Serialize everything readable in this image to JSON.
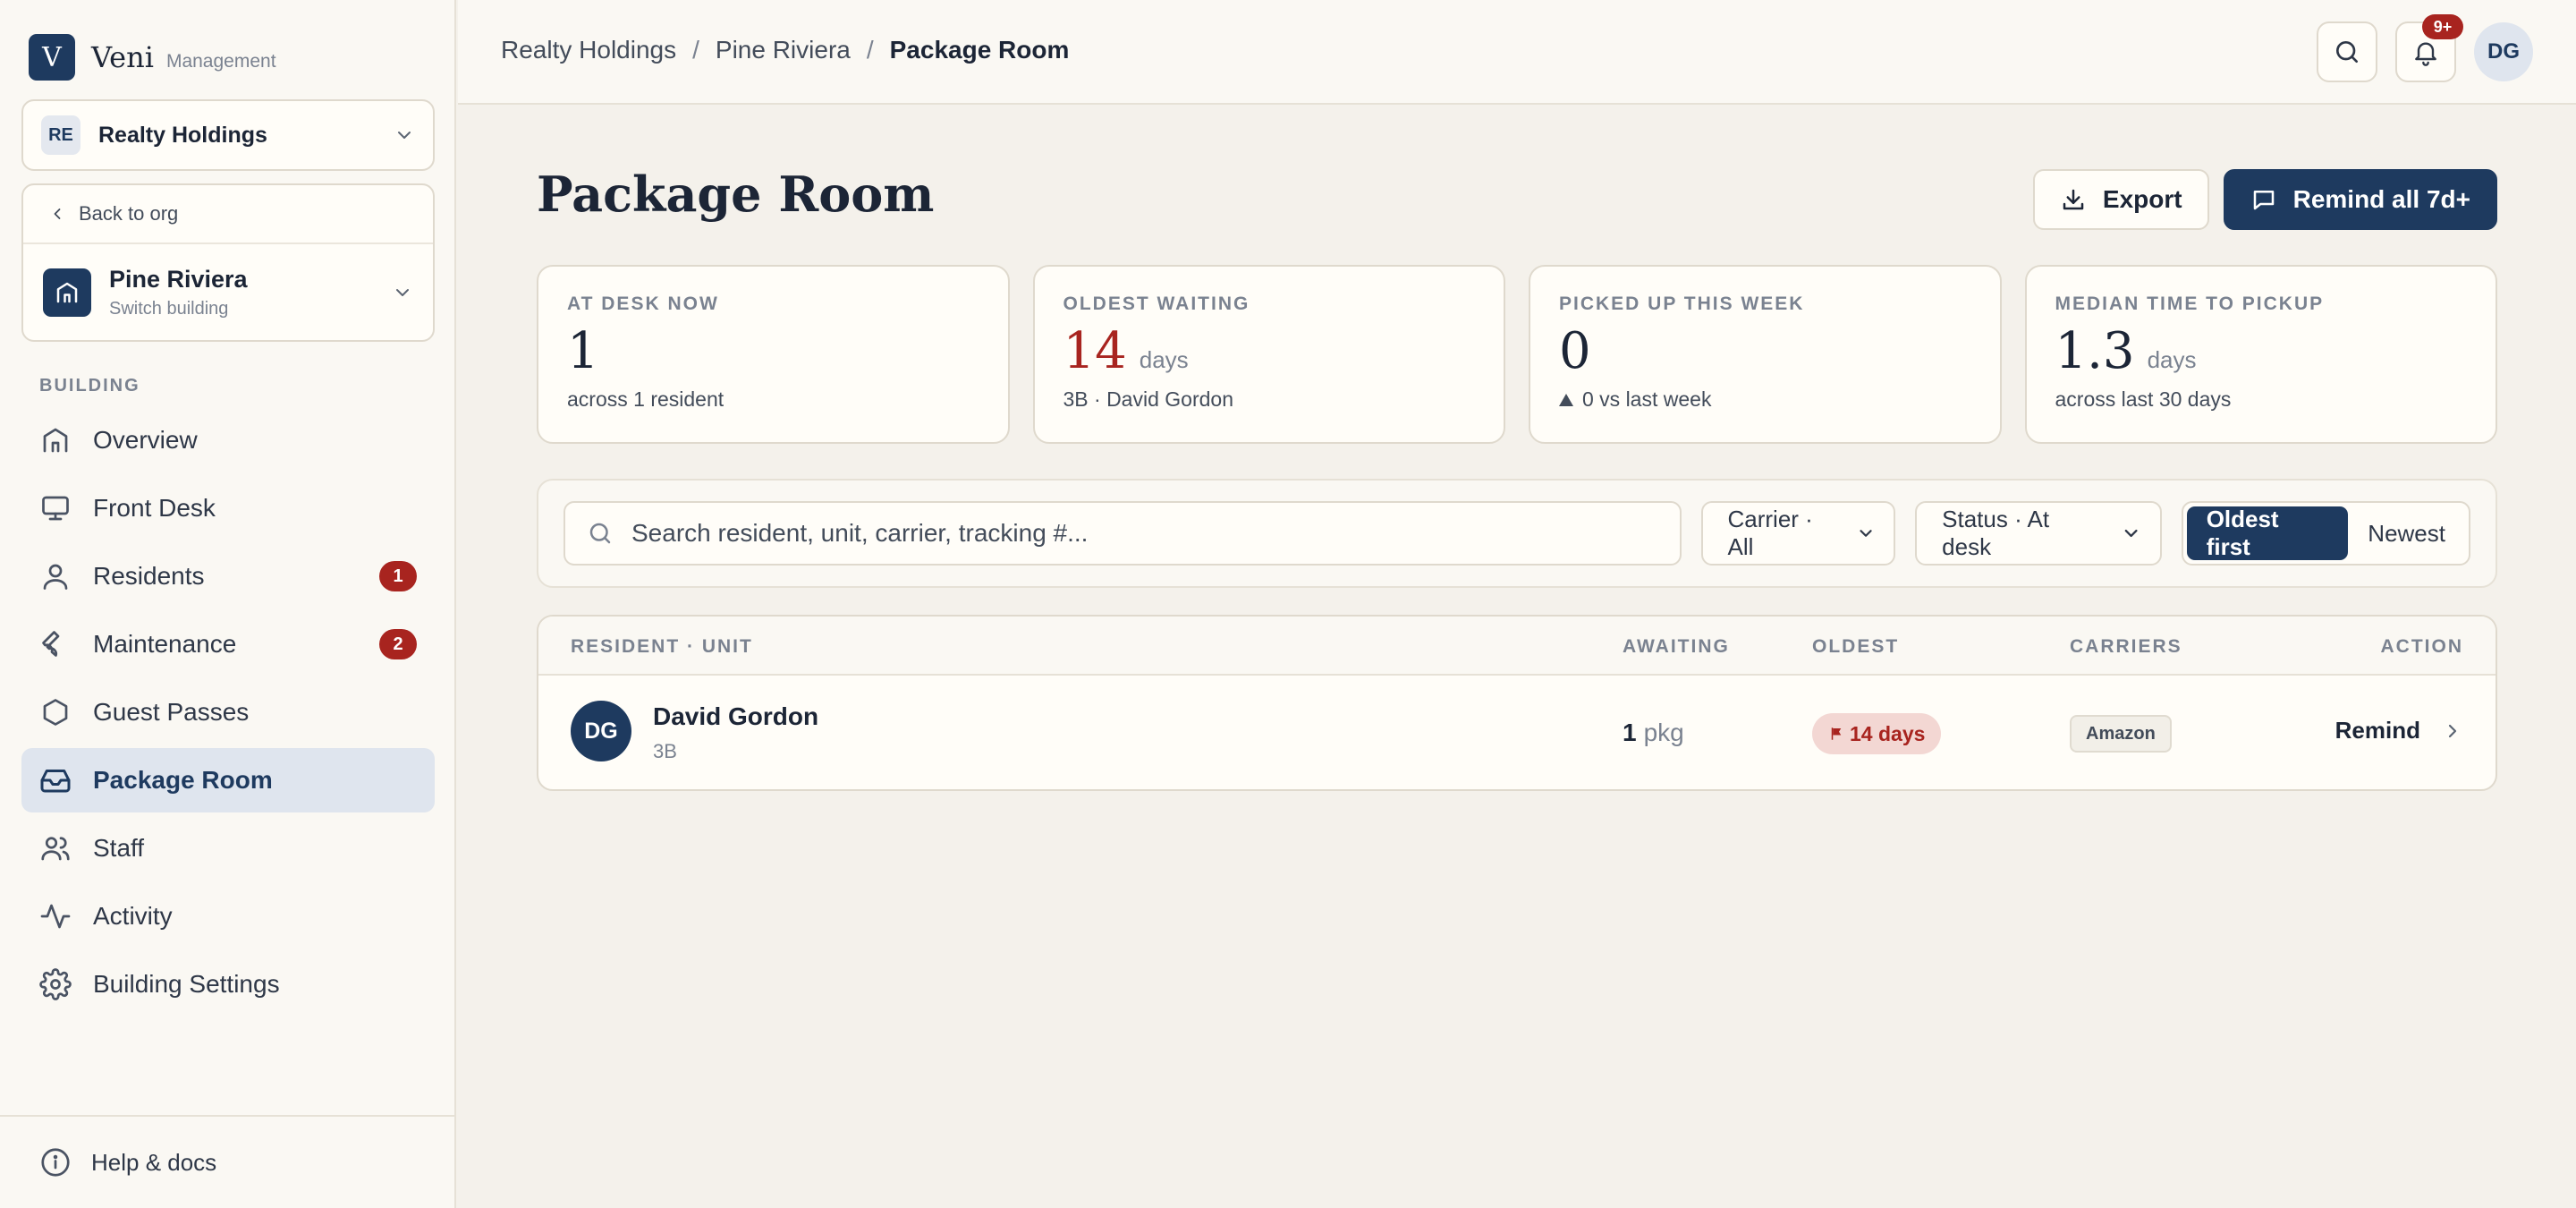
{
  "brand": {
    "logo_letter": "V",
    "name": "Veni",
    "sub": "Management"
  },
  "org": {
    "badge": "RE",
    "name": "Realty Holdings"
  },
  "building": {
    "back_label": "Back to org",
    "name": "Pine Riviera",
    "sub": "Switch building"
  },
  "nav": {
    "section_label": "BUILDING",
    "items": [
      {
        "label": "Overview",
        "icon": "home-icon"
      },
      {
        "label": "Front Desk",
        "icon": "monitor-icon"
      },
      {
        "label": "Residents",
        "icon": "user-icon",
        "badge": "1"
      },
      {
        "label": "Maintenance",
        "icon": "wrench-icon",
        "badge": "2"
      },
      {
        "label": "Guest Passes",
        "icon": "hexagon-icon"
      },
      {
        "label": "Package Room",
        "icon": "inbox-icon",
        "active": true
      },
      {
        "label": "Staff",
        "icon": "users-icon"
      },
      {
        "label": "Activity",
        "icon": "activity-icon"
      },
      {
        "label": "Building Settings",
        "icon": "gear-icon"
      }
    ],
    "footer_label": "Help & docs"
  },
  "topbar": {
    "breadcrumb": [
      "Realty Holdings",
      "Pine Riviera",
      "Package Room"
    ],
    "separator": "/",
    "notif_badge": "9+",
    "user_initials": "DG"
  },
  "page": {
    "title": "Package Room",
    "export_label": "Export",
    "remind_all_label": "Remind all 7d+"
  },
  "stats": [
    {
      "label": "AT DESK NOW",
      "value": "1",
      "unit": "",
      "sub": "across 1 resident"
    },
    {
      "label": "OLDEST WAITING",
      "value": "14",
      "unit": "days",
      "sub": "3B · David Gordon"
    },
    {
      "label": "PICKED UP THIS WEEK",
      "value": "0",
      "unit": "",
      "sub": "0 vs last week"
    },
    {
      "label": "MEDIAN TIME TO PICKUP",
      "value": "1.3",
      "unit": "days",
      "sub": "across last 30 days"
    }
  ],
  "filters": {
    "search_placeholder": "Search resident, unit, carrier, tracking #...",
    "carrier": "Carrier · All",
    "status": "Status · At desk",
    "sort_options": [
      "Oldest first",
      "Newest"
    ],
    "sort_active": "Oldest first"
  },
  "table": {
    "headers": {
      "resident": "RESIDENT · UNIT",
      "awaiting": "AWAITING",
      "oldest": "OLDEST",
      "carriers": "CARRIERS",
      "action": "ACTION"
    },
    "rows": [
      {
        "initials": "DG",
        "name": "David Gordon",
        "unit": "3B",
        "count": "1",
        "count_unit": "pkg",
        "oldest": "14 days",
        "carrier": "Amazon",
        "action": "Remind"
      }
    ]
  },
  "colors": {
    "accent": "#1e3a5f",
    "alert": "#a8241f",
    "background": "#f4f1eb"
  }
}
